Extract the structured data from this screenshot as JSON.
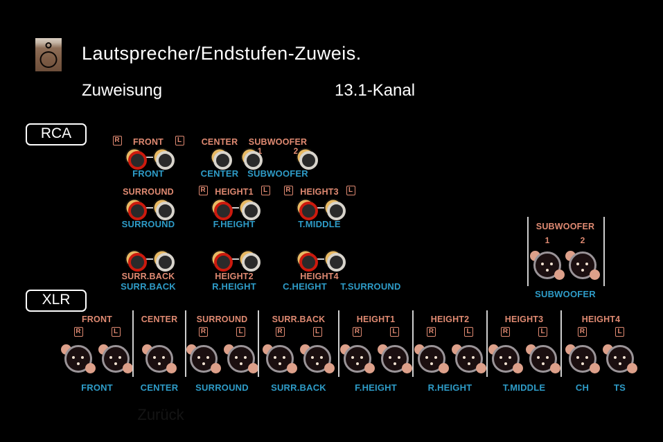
{
  "header": {
    "icon": "speaker-icon",
    "title": "Lautsprecher/Endstufen-Zuweis.",
    "setting_label": "Zuweisung",
    "setting_value": "13.1-Kanal"
  },
  "sections": {
    "rca_pill": "RCA",
    "xlr_pill": "XLR"
  },
  "colors": {
    "accent_salmon": "#e08a72",
    "accent_blue": "#2e9cc8",
    "background": "#000000",
    "pill_border": "#ffffff",
    "button_brown": "#8d6a52"
  },
  "rca": {
    "row1": [
      {
        "top_label": "FRONT",
        "bottom_label": "FRONT",
        "badges": [
          "R",
          "L"
        ],
        "jacks": [
          "red",
          "white"
        ],
        "linked": true
      },
      {
        "top_label": "CENTER",
        "bottom_label": "CENTER",
        "badges": [],
        "jacks": [
          "white"
        ],
        "linked": false
      },
      {
        "top_label": "SUBWOOFER",
        "bottom_label": "SUBWOOFER",
        "numbers": [
          "1",
          "2"
        ],
        "jacks": [
          "white",
          "white"
        ],
        "linked": false
      }
    ],
    "row2": [
      {
        "top_label": "SURROUND",
        "bottom_label": "SURROUND",
        "badges": [],
        "jacks": [
          "red",
          "white"
        ],
        "linked": true
      },
      {
        "top_label": "HEIGHT1",
        "bottom_label": "F.HEIGHT",
        "badges": [
          "R",
          "L"
        ],
        "jacks": [
          "red",
          "white"
        ],
        "linked": true
      },
      {
        "top_label": "HEIGHT3",
        "bottom_label": "T.MIDDLE",
        "badges": [
          "R",
          "L"
        ],
        "jacks": [
          "red",
          "white"
        ],
        "linked": true
      }
    ],
    "row3": [
      {
        "top_label": "SURR.BACK",
        "bottom_label": "SURR.BACK",
        "badges": [],
        "jacks": [
          "red",
          "white"
        ],
        "linked": true
      },
      {
        "top_label": "HEIGHT2",
        "bottom_label": "R.HEIGHT",
        "badges": [],
        "jacks": [
          "red",
          "white"
        ],
        "linked": true
      },
      {
        "top_label": "HEIGHT4",
        "bottom_label_left": "C.HEIGHT",
        "bottom_label_right": "T.SURROUND",
        "badges": [],
        "jacks": [
          "red",
          "white"
        ],
        "linked": true
      }
    ]
  },
  "xlr_subwoofer": {
    "top_label": "SUBWOOFER",
    "numbers": [
      "1",
      "2"
    ],
    "bottom_label": "SUBWOOFER"
  },
  "xlr_row": [
    {
      "top_label": "FRONT",
      "badges": [
        "R",
        "L"
      ],
      "bottom_labels": [
        "FRONT"
      ],
      "jack_count": 2
    },
    {
      "top_label": "CENTER",
      "badges": [],
      "bottom_labels": [
        "CENTER"
      ],
      "jack_count": 1
    },
    {
      "top_label": "SURROUND",
      "badges": [
        "R",
        "L"
      ],
      "bottom_labels": [
        "SURROUND"
      ],
      "jack_count": 2
    },
    {
      "top_label": "SURR.BACK",
      "badges": [
        "R",
        "L"
      ],
      "bottom_labels": [
        "SURR.BACK"
      ],
      "jack_count": 2
    },
    {
      "top_label": "HEIGHT1",
      "badges": [
        "R",
        "L"
      ],
      "bottom_labels": [
        "F.HEIGHT"
      ],
      "jack_count": 2
    },
    {
      "top_label": "HEIGHT2",
      "badges": [
        "R",
        "L"
      ],
      "bottom_labels": [
        "R.HEIGHT"
      ],
      "jack_count": 2
    },
    {
      "top_label": "HEIGHT3",
      "badges": [
        "R",
        "L"
      ],
      "bottom_labels": [
        "T.MIDDLE"
      ],
      "jack_count": 2
    },
    {
      "top_label": "HEIGHT4",
      "badges": [
        "R",
        "L"
      ],
      "bottom_labels": [
        "CH",
        "TS"
      ],
      "jack_count": 2
    }
  ],
  "footer": {
    "back_label": "Zurück"
  }
}
